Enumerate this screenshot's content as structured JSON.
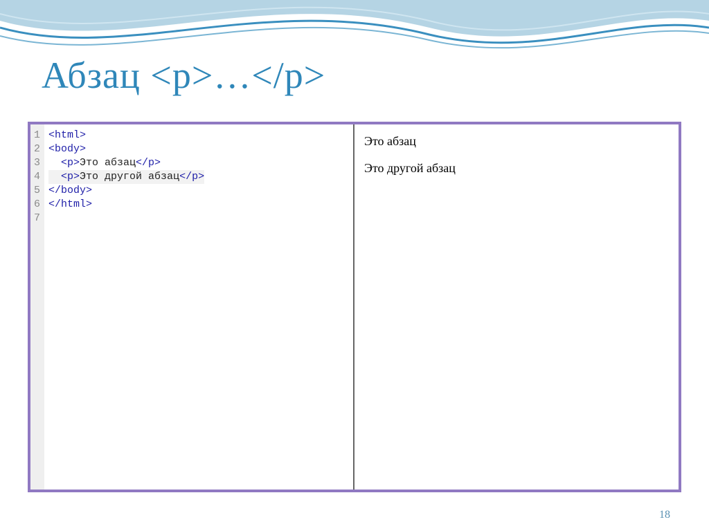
{
  "title": "Абзац  <p>…</p>",
  "code": {
    "lineNumbers": [
      "1",
      "2",
      "3",
      "4",
      "5",
      "6",
      "7"
    ],
    "highlightIndex": 3,
    "lines": [
      [
        {
          "t": "tag",
          "v": "<html>"
        }
      ],
      [
        {
          "t": "tag",
          "v": "<body>"
        }
      ],
      [
        {
          "t": "plain",
          "v": "  "
        },
        {
          "t": "tag",
          "v": "<p>"
        },
        {
          "t": "plain",
          "v": "Это абзац"
        },
        {
          "t": "tag",
          "v": "</p>"
        }
      ],
      [
        {
          "t": "plain",
          "v": "  "
        },
        {
          "t": "tag",
          "v": "<p>"
        },
        {
          "t": "plain",
          "v": "Это другой абзац"
        },
        {
          "t": "tag",
          "v": "</p>"
        }
      ],
      [
        {
          "t": "tag",
          "v": "</body>"
        }
      ],
      [
        {
          "t": "tag",
          "v": "</html>"
        }
      ],
      [
        {
          "t": "plain",
          "v": ""
        }
      ]
    ]
  },
  "rendered": {
    "p1": "Это абзац",
    "p2": "Это другой абзац"
  },
  "pageNumber": "18"
}
